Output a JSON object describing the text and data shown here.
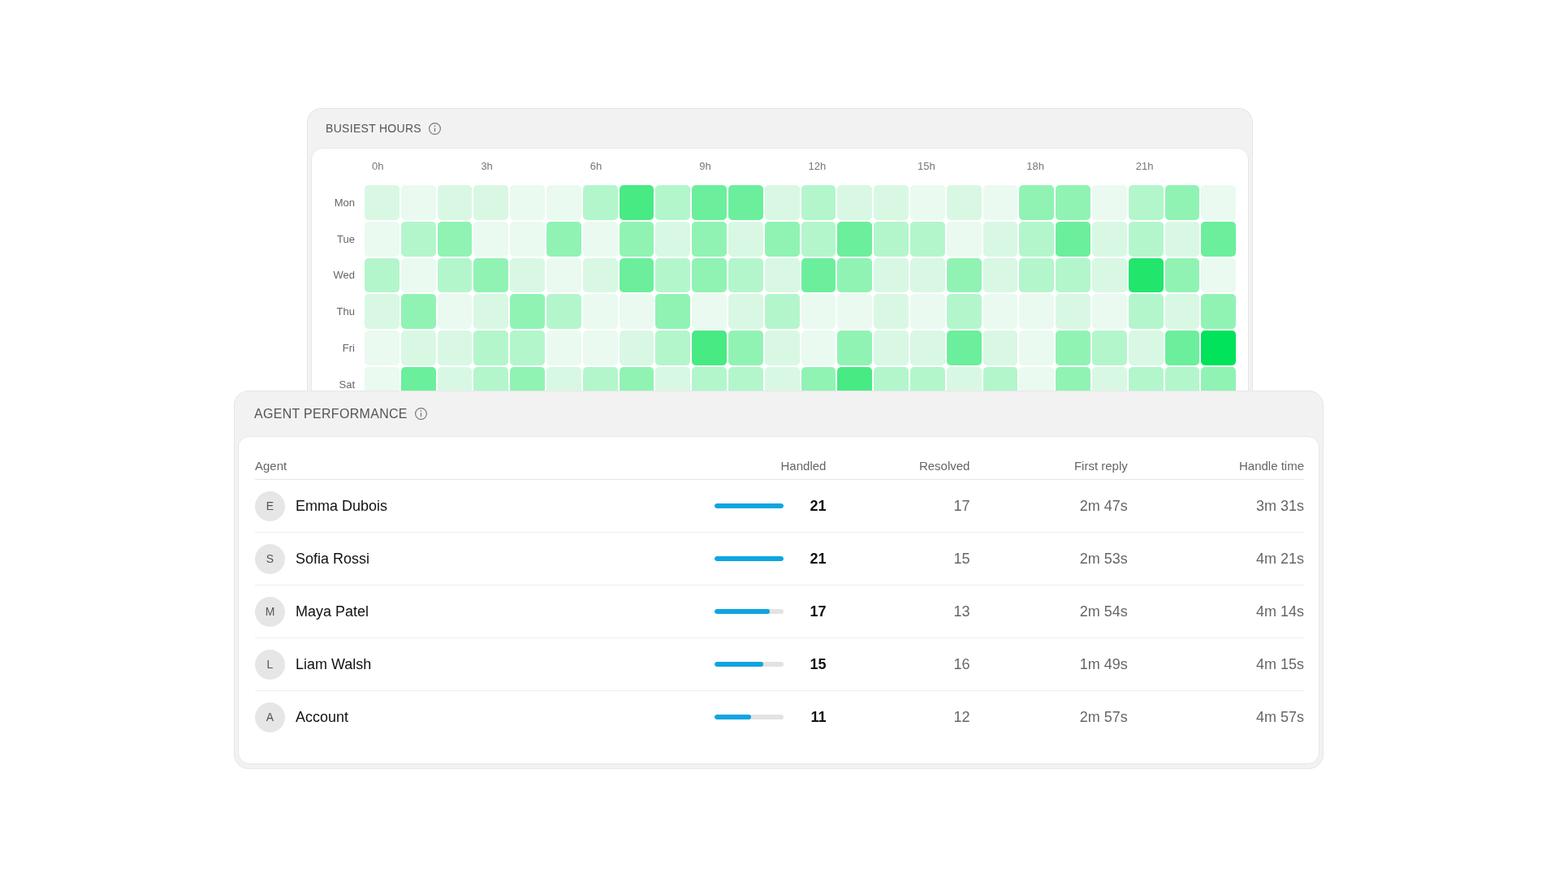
{
  "busiest_hours": {
    "title": "BUSIEST HOURS",
    "hours": [
      "0h",
      "3h",
      "6h",
      "9h",
      "12h",
      "15h",
      "18h",
      "21h"
    ],
    "rows": [
      {
        "day": "Mon",
        "cells": [
          {
            "color": "#d8f8e4"
          },
          {
            "color": "#eafaf0"
          },
          {
            "color": "#d8f8e4"
          },
          {
            "color": "#d8f8e4"
          },
          {
            "color": "#eafaf0"
          },
          {
            "color": "#eafaf0"
          },
          {
            "color": "#b3f6cc"
          },
          {
            "color": "#48ea84"
          },
          {
            "color": "#b3f6cc"
          },
          {
            "color": "#6bef9c"
          },
          {
            "color": "#6bef9c"
          },
          {
            "color": "#d8f8e4"
          },
          {
            "color": "#b3f6cc"
          },
          {
            "color": "#d8f8e4"
          },
          {
            "color": "#d8f8e4"
          },
          {
            "color": "#eafaf0"
          },
          {
            "color": "#d8f8e4"
          },
          {
            "color": "#eafaf0"
          },
          {
            "color": "#90f3b4"
          },
          {
            "color": "#90f3b4"
          },
          {
            "color": "#eafaf0"
          },
          {
            "color": "#b3f6cc"
          },
          {
            "color": "#90f3b4"
          },
          {
            "color": "#eafaf0"
          }
        ]
      },
      {
        "day": "Tue",
        "cells": [
          {
            "color": "#eafaf0"
          },
          {
            "color": "#b3f6cc"
          },
          {
            "color": "#90f3b4"
          },
          {
            "color": "#eafaf0"
          },
          {
            "color": "#eafaf0"
          },
          {
            "color": "#90f3b4"
          },
          {
            "color": "#eafaf0"
          },
          {
            "color": "#90f3b4"
          },
          {
            "color": "#d8f8e4"
          },
          {
            "color": "#90f3b4"
          },
          {
            "color": "#d8f8e4"
          },
          {
            "color": "#90f3b4"
          },
          {
            "color": "#b3f6cc"
          },
          {
            "color": "#6bef9c"
          },
          {
            "color": "#b3f6cc"
          },
          {
            "color": "#b3f6cc"
          },
          {
            "color": "#eafaf0"
          },
          {
            "color": "#d8f8e4"
          },
          {
            "color": "#b3f6cc"
          },
          {
            "color": "#6bef9c"
          },
          {
            "color": "#d8f8e4"
          },
          {
            "color": "#b3f6cc"
          },
          {
            "color": "#d8f8e4"
          },
          {
            "color": "#6bef9c"
          }
        ]
      },
      {
        "day": "Wed",
        "cells": [
          {
            "color": "#b3f6cc"
          },
          {
            "color": "#eafaf0"
          },
          {
            "color": "#b3f6cc"
          },
          {
            "color": "#90f3b4"
          },
          {
            "color": "#d8f8e4"
          },
          {
            "color": "#eafaf0"
          },
          {
            "color": "#d8f8e4"
          },
          {
            "color": "#6bef9c"
          },
          {
            "color": "#b3f6cc"
          },
          {
            "color": "#90f3b4"
          },
          {
            "color": "#b3f6cc"
          },
          {
            "color": "#d8f8e4"
          },
          {
            "color": "#6bef9c"
          },
          {
            "color": "#90f3b4"
          },
          {
            "color": "#d8f8e4"
          },
          {
            "color": "#d8f8e4"
          },
          {
            "color": "#90f3b4"
          },
          {
            "color": "#d8f8e4"
          },
          {
            "color": "#b3f6cc"
          },
          {
            "color": "#b3f6cc"
          },
          {
            "color": "#d8f8e4"
          },
          {
            "color": "#22e66c"
          },
          {
            "color": "#90f3b4"
          },
          {
            "color": "#eafaf0"
          }
        ]
      },
      {
        "day": "Thu",
        "cells": [
          {
            "color": "#d8f8e4"
          },
          {
            "color": "#90f3b4"
          },
          {
            "color": "#eafaf0"
          },
          {
            "color": "#d8f8e4"
          },
          {
            "color": "#90f3b4"
          },
          {
            "color": "#b3f6cc"
          },
          {
            "color": "#eafaf0"
          },
          {
            "color": "#eafaf0"
          },
          {
            "color": "#90f3b4"
          },
          {
            "color": "#eafaf0"
          },
          {
            "color": "#d8f8e4"
          },
          {
            "color": "#b3f6cc"
          },
          {
            "color": "#eafaf0"
          },
          {
            "color": "#eafaf0"
          },
          {
            "color": "#d8f8e4"
          },
          {
            "color": "#eafaf0"
          },
          {
            "color": "#b3f6cc"
          },
          {
            "color": "#eafaf0"
          },
          {
            "color": "#eafaf0"
          },
          {
            "color": "#d8f8e4"
          },
          {
            "color": "#eafaf0"
          },
          {
            "color": "#b3f6cc"
          },
          {
            "color": "#d8f8e4"
          },
          {
            "color": "#90f3b4"
          }
        ]
      },
      {
        "day": "Fri",
        "cells": [
          {
            "color": "#eafaf0"
          },
          {
            "color": "#d8f8e4"
          },
          {
            "color": "#d8f8e4"
          },
          {
            "color": "#b3f6cc"
          },
          {
            "color": "#b3f6cc"
          },
          {
            "color": "#eafaf0"
          },
          {
            "color": "#eafaf0"
          },
          {
            "color": "#d8f8e4"
          },
          {
            "color": "#b3f6cc"
          },
          {
            "color": "#48ea84"
          },
          {
            "color": "#90f3b4"
          },
          {
            "color": "#d8f8e4"
          },
          {
            "color": "#eafaf0"
          },
          {
            "color": "#90f3b4"
          },
          {
            "color": "#d8f8e4"
          },
          {
            "color": "#d8f8e4"
          },
          {
            "color": "#6bef9c"
          },
          {
            "color": "#d8f8e4"
          },
          {
            "color": "#eafaf0"
          },
          {
            "color": "#90f3b4"
          },
          {
            "color": "#b3f6cc"
          },
          {
            "color": "#d8f8e4"
          },
          {
            "color": "#6bef9c"
          },
          {
            "color": "#00e35a"
          }
        ]
      },
      {
        "day": "Sat",
        "cells": [
          {
            "color": "#eafaf0"
          },
          {
            "color": "#6bef9c"
          },
          {
            "color": "#d8f8e4"
          },
          {
            "color": "#b3f6cc"
          },
          {
            "color": "#90f3b4"
          },
          {
            "color": "#d8f8e4"
          },
          {
            "color": "#b3f6cc"
          },
          {
            "color": "#90f3b4"
          },
          {
            "color": "#d8f8e4"
          },
          {
            "color": "#b3f6cc"
          },
          {
            "color": "#b3f6cc"
          },
          {
            "color": "#d8f8e4"
          },
          {
            "color": "#90f3b4"
          },
          {
            "color": "#48ea84"
          },
          {
            "color": "#b3f6cc"
          },
          {
            "color": "#b3f6cc"
          },
          {
            "color": "#d8f8e4"
          },
          {
            "color": "#b3f6cc"
          },
          {
            "color": "#eafaf0"
          },
          {
            "color": "#90f3b4"
          },
          {
            "color": "#d8f8e4"
          },
          {
            "color": "#b3f6cc"
          },
          {
            "color": "#b3f6cc"
          },
          {
            "color": "#90f3b4"
          }
        ]
      }
    ]
  },
  "agent_performance": {
    "title": "AGENT PERFORMANCE",
    "columns": [
      "Agent",
      "Handled",
      "Resolved",
      "First reply",
      "Handle time"
    ],
    "rows": [
      {
        "initial": "E",
        "name": "Emma Dubois",
        "level": 1,
        "handled": "21",
        "resolved": "17",
        "first_reply": "2m 47s",
        "handle_time": "3m 31s"
      },
      {
        "initial": "S",
        "name": "Sofia Rossi",
        "level": 1,
        "handled": "21",
        "resolved": "15",
        "first_reply": "2m 53s",
        "handle_time": "4m 21s"
      },
      {
        "initial": "M",
        "name": "Maya Patel",
        "level": 0.8,
        "handled": "17",
        "resolved": "13",
        "first_reply": "2m 54s",
        "handle_time": "4m 14s"
      },
      {
        "initial": "L",
        "name": "Liam Walsh",
        "level": 0.7,
        "handled": "15",
        "resolved": "16",
        "first_reply": "1m 49s",
        "handle_time": "4m 15s"
      },
      {
        "initial": "A",
        "name": "Account",
        "level": 0.52,
        "handled": "11",
        "resolved": "12",
        "first_reply": "2m 57s",
        "handle_time": "4m 57s"
      }
    ]
  }
}
